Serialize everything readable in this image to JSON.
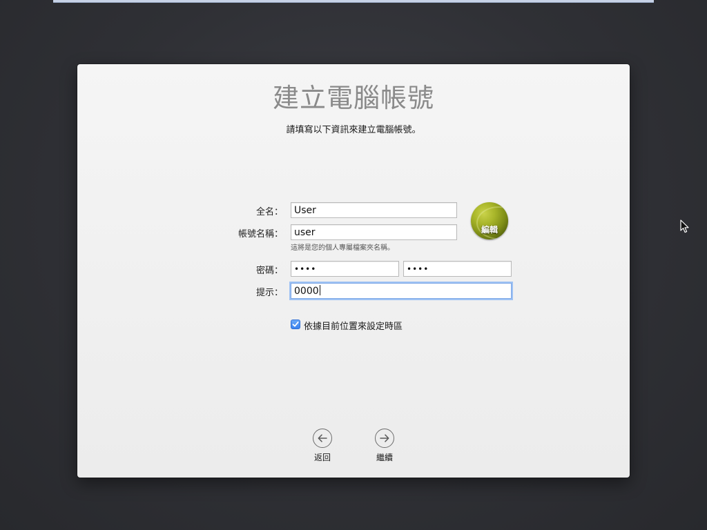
{
  "page": {
    "title": "建立電腦帳號",
    "subtitle": "請填寫以下資訊來建立電腦帳號。"
  },
  "form": {
    "full_name": {
      "label": "全名：",
      "value": "User"
    },
    "account_name": {
      "label": "帳號名稱：",
      "value": "user",
      "help": "這將是您的個人專屬檔案夾名稱。"
    },
    "password": {
      "label": "密碼：",
      "value": "••••",
      "verify_value": "••••"
    },
    "hint": {
      "label": "提示：",
      "value": "0000"
    },
    "avatar": {
      "edit_label": "編輯",
      "icon": "tennis-ball-picture"
    },
    "timezone_checkbox": {
      "label": "依據目前位置來設定時區",
      "checked": true
    }
  },
  "nav": {
    "back": {
      "label": "返回",
      "icon": "arrow-left-circle-icon"
    },
    "continue": {
      "label": "繼續",
      "icon": "arrow-right-circle-icon"
    }
  },
  "colors": {
    "accent": "#3a82ee",
    "title_gray": "#8a8a8a",
    "focus_ring": "#9ec2f4"
  }
}
